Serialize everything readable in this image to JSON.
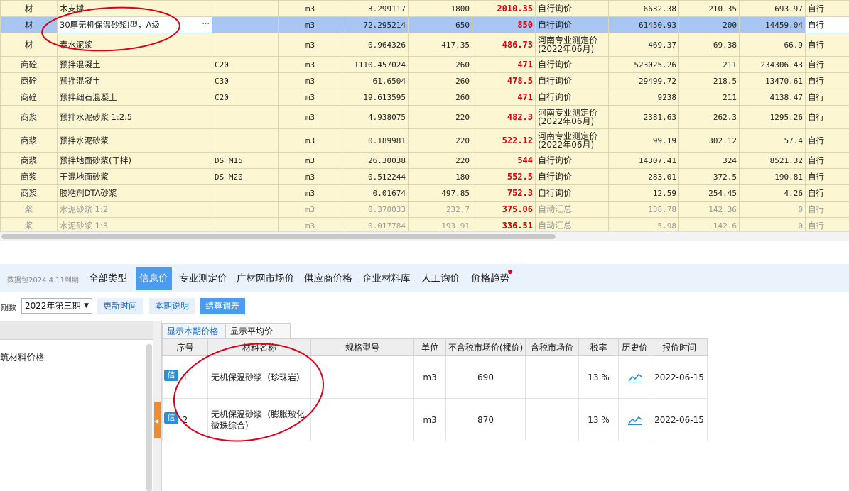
{
  "materials": [
    {
      "type": "材",
      "name": "木支撑",
      "spec": "",
      "unit": "m3",
      "qty": "3.299117",
      "base_price": "1800",
      "price": "2010.35",
      "source": "自行询价",
      "amount": "6632.38",
      "c11": "210.35",
      "c12": "693.97",
      "c13": "自行"
    },
    {
      "type": "材",
      "name": "30厚无机保温砂浆I型，A级",
      "spec": "",
      "unit": "m3",
      "qty": "72.295214",
      "base_price": "650",
      "price": "850",
      "source": "自行询价",
      "amount": "61450.93",
      "c11": "200",
      "c12": "14459.04",
      "c13": "自行"
    },
    {
      "type": "材",
      "name": "素水泥浆",
      "spec": "",
      "unit": "m3",
      "qty": "0.964326",
      "base_price": "417.35",
      "price": "486.73",
      "source": "河南专业测定价(2022年06月)",
      "amount": "469.37",
      "c11": "69.38",
      "c12": "66.9",
      "c13": "自行"
    },
    {
      "type": "商砼",
      "name": "预拌混凝土",
      "spec": "C20",
      "unit": "m3",
      "qty": "1110.457024",
      "base_price": "260",
      "price": "471",
      "source": "自行询价",
      "amount": "523025.26",
      "c11": "211",
      "c12": "234306.43",
      "c13": "自行"
    },
    {
      "type": "商砼",
      "name": "预拌混凝土",
      "spec": "C30",
      "unit": "m3",
      "qty": "61.6504",
      "base_price": "260",
      "price": "478.5",
      "source": "自行询价",
      "amount": "29499.72",
      "c11": "218.5",
      "c12": "13470.61",
      "c13": "自行"
    },
    {
      "type": "商砼",
      "name": "预拌细石混凝土",
      "spec": "C20",
      "unit": "m3",
      "qty": "19.613595",
      "base_price": "260",
      "price": "471",
      "source": "自行询价",
      "amount": "9238",
      "c11": "211",
      "c12": "4138.47",
      "c13": "自行"
    },
    {
      "type": "商浆",
      "name": "预拌水泥砂浆 1:2.5",
      "spec": "",
      "unit": "m3",
      "qty": "4.938075",
      "base_price": "220",
      "price": "482.3",
      "source": "河南专业测定价(2022年06月)",
      "amount": "2381.63",
      "c11": "262.3",
      "c12": "1295.26",
      "c13": "自行"
    },
    {
      "type": "商浆",
      "name": "预拌水泥砂浆",
      "spec": "",
      "unit": "m3",
      "qty": "0.189981",
      "base_price": "220",
      "price": "522.12",
      "source": "河南专业测定价(2022年06月)",
      "amount": "99.19",
      "c11": "302.12",
      "c12": "57.4",
      "c13": "自行"
    },
    {
      "type": "商浆",
      "name": "预拌地面砂浆(干拌)",
      "spec": "DS M15",
      "unit": "m3",
      "qty": "26.30038",
      "base_price": "220",
      "price": "544",
      "source": "自行询价",
      "amount": "14307.41",
      "c11": "324",
      "c12": "8521.32",
      "c13": "自行"
    },
    {
      "type": "商浆",
      "name": "干混地面砂浆",
      "spec": "DS M20",
      "unit": "m3",
      "qty": "0.512244",
      "base_price": "180",
      "price": "552.5",
      "source": "自行询价",
      "amount": "283.01",
      "c11": "372.5",
      "c12": "190.81",
      "c13": "自行"
    },
    {
      "type": "商浆",
      "name": "胶粘剂DTA砂浆",
      "spec": "",
      "unit": "m3",
      "qty": "0.01674",
      "base_price": "497.85",
      "price": "752.3",
      "source": "自行询价",
      "amount": "12.59",
      "c11": "254.45",
      "c12": "4.26",
      "c13": "自行"
    },
    {
      "type": "浆",
      "name": "水泥砂浆 1:2",
      "spec": "",
      "unit": "m3",
      "qty": "0.370033",
      "base_price": "232.7",
      "price": "375.06",
      "source": "自动汇总",
      "amount": "138.78",
      "c11": "142.36",
      "c12": "0",
      "c13": "自行"
    },
    {
      "type": "浆",
      "name": "水泥砂浆 1:3",
      "spec": "",
      "unit": "m3",
      "qty": "0.017784",
      "base_price": "193.91",
      "price": "336.51",
      "source": "自动汇总",
      "amount": "5.98",
      "c11": "142.6",
      "c12": "0",
      "c13": "自行"
    }
  ],
  "tabbar": {
    "package_label": "数据包2024.4.11到期",
    "tabs": [
      "全部类型",
      "信息价",
      "专业测定价",
      "广材网市场价",
      "供应商价格",
      "企业材料库",
      "人工询价",
      "价格趋势"
    ],
    "active_tab": "信息价"
  },
  "period": {
    "label": "期数",
    "selected": "2022年第三期",
    "update_btn": "更新时间",
    "desc_btn": "本期说明",
    "settle_btn": "结算调差"
  },
  "left_panel": {
    "item": "筑材料价格"
  },
  "price_panel": {
    "subtabs": [
      "显示本期价格",
      "显示平均价"
    ],
    "headers": [
      "序号",
      "材料名称",
      "规格型号",
      "单位",
      "不含税市场价(裸价)",
      "含税市场价",
      "税率",
      "历史价",
      "报价时间"
    ],
    "badge": "信",
    "rows": [
      {
        "no": "1",
        "name": "无机保温砂浆（珍珠岩）",
        "spec": "",
        "unit": "m3",
        "price_ex_tax": "690",
        "price_inc_tax": "",
        "tax_rate": "13 %",
        "date": "2022-06-15"
      },
      {
        "no": "2",
        "name": "无机保温砂浆（膨胀玻化微珠综合）",
        "spec": "",
        "unit": "m3",
        "price_ex_tax": "870",
        "price_inc_tax": "",
        "tax_rate": "13 %",
        "date": "2022-06-15"
      }
    ]
  },
  "colors": {
    "accent": "#4b9cf0",
    "row_yellow": "#fcf7d2",
    "selected_row": "#a8c6f2",
    "price_red": "#e0000f",
    "annotation_red": "#e0001b"
  }
}
